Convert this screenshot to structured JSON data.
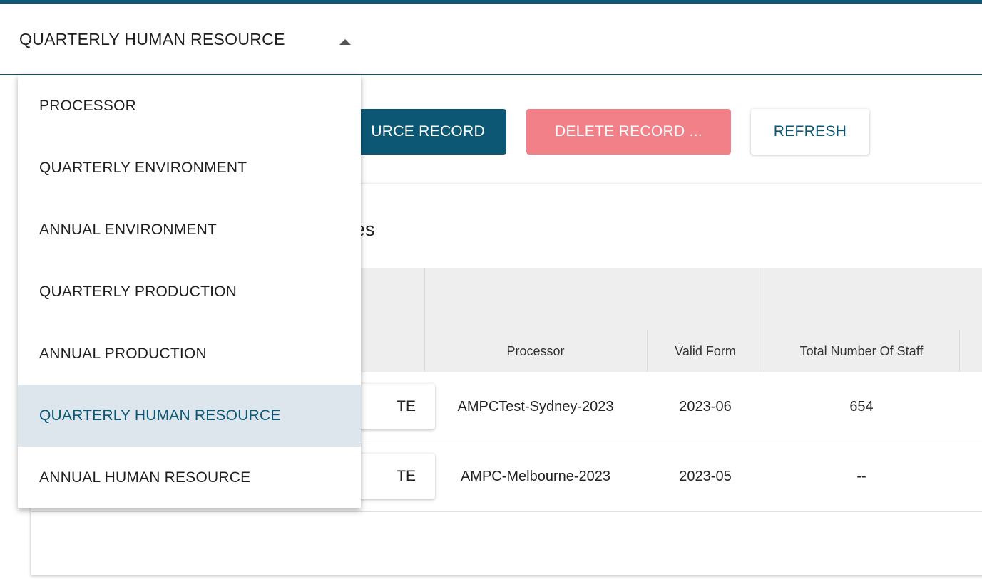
{
  "selector": {
    "label": "QUARTERLY HUMAN RESOURCE"
  },
  "toolbar": {
    "primary_label": "URCE RECORD",
    "delete_label": "DELETE RECORD ...",
    "refresh_label": "REFRESH"
  },
  "card": {
    "title_fragment": "es"
  },
  "table": {
    "columns": [
      "Processor",
      "Valid Form",
      "Total Number Of Staff"
    ],
    "rows": [
      {
        "action": "TE",
        "processor": "AMPCTest-Sydney-2023",
        "valid_form": "2023-06",
        "total_staff": "654"
      },
      {
        "action": "TE",
        "processor": "AMPC-Melbourne-2023",
        "valid_form": "2023-05",
        "total_staff": "--"
      }
    ]
  },
  "menu": {
    "items": [
      "PROCESSOR",
      "QUARTERLY ENVIRONMENT",
      "ANNUAL ENVIRONMENT",
      "QUARTERLY PRODUCTION",
      "ANNUAL PRODUCTION",
      "QUARTERLY HUMAN RESOURCE",
      "ANNUAL HUMAN RESOURCE"
    ],
    "selected": "QUARTERLY HUMAN RESOURCE"
  },
  "colors": {
    "brand": "#0c5874",
    "danger": "#f28088",
    "selected_bg": "#dde6ec"
  }
}
